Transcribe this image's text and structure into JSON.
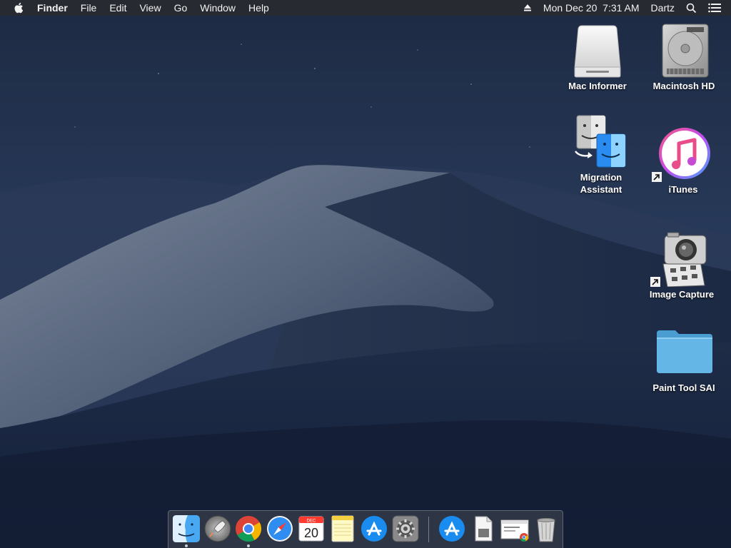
{
  "menubar": {
    "app_name": "Finder",
    "menus": [
      "File",
      "Edit",
      "View",
      "Go",
      "Window",
      "Help"
    ],
    "datetime": "Mon Dec 20  7:31 AM",
    "user": "Dartz",
    "icons": [
      "apple-icon",
      "eject-icon",
      "spotlight-search-icon",
      "notification-center-icon"
    ]
  },
  "desktop": {
    "icons": [
      {
        "label": "Mac Informer",
        "icon": "external-drive-icon"
      },
      {
        "label": "Macintosh HD",
        "icon": "hard-drive-icon"
      },
      {
        "label": "Migration\nAssistant",
        "line1": "Migration",
        "line2": "Assistant",
        "icon": "migration-assistant-icon"
      },
      {
        "label": "iTunes",
        "icon": "itunes-icon"
      },
      {
        "label": "Image Capture",
        "icon": "image-capture-icon"
      },
      {
        "label": "Paint Tool SAI",
        "icon": "folder-icon"
      }
    ]
  },
  "dock": {
    "apps": [
      "Finder",
      "Launchpad",
      "Google Chrome",
      "Safari",
      "Calendar",
      "Notes",
      "App Store",
      "System Preferences",
      "App Store Installer",
      "Preview Document",
      "Chrome Window",
      "Trash"
    ],
    "calendar": {
      "month": "DEC",
      "day": "20"
    },
    "running": [
      "Finder",
      "Google Chrome"
    ]
  },
  "colors": {
    "menubar_bg": "#2a2c30",
    "folder_blue": "#5ab0e0",
    "accent_blue": "#1a8cf0"
  }
}
